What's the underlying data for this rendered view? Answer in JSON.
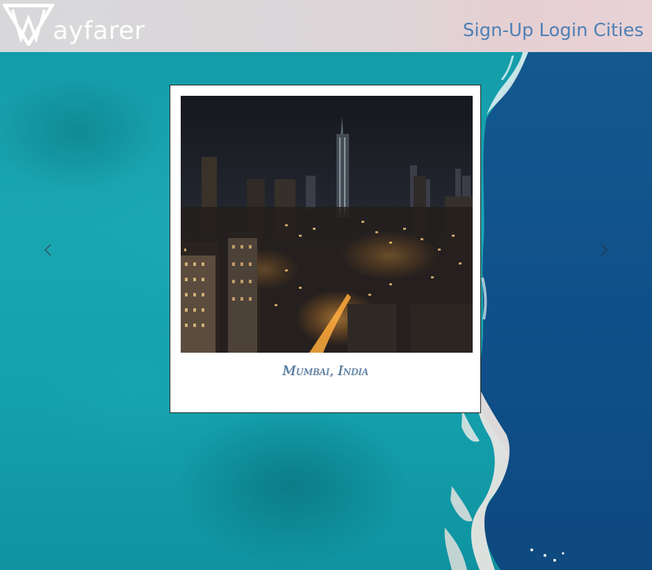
{
  "app": {
    "brand": "Wayfarer",
    "brand_rest": "ayfarer",
    "logo_icon": "w-triangle-logo"
  },
  "nav": {
    "items": [
      {
        "label": "Sign-Up"
      },
      {
        "label": "Login"
      },
      {
        "label": "Cities"
      }
    ]
  },
  "carousel": {
    "prev_icon": "chevron-left-icon",
    "next_icon": "chevron-right-icon",
    "slide": {
      "caption": "Mumbai, India",
      "image": "night-city-skyline-photo"
    }
  },
  "colors": {
    "nav_text": "#4d7fb5",
    "caption_text": "#3d6e9e",
    "header_bg": "#d8d8da",
    "ocean_teal": "#1aa6b1",
    "ocean_deep": "#12558e"
  }
}
